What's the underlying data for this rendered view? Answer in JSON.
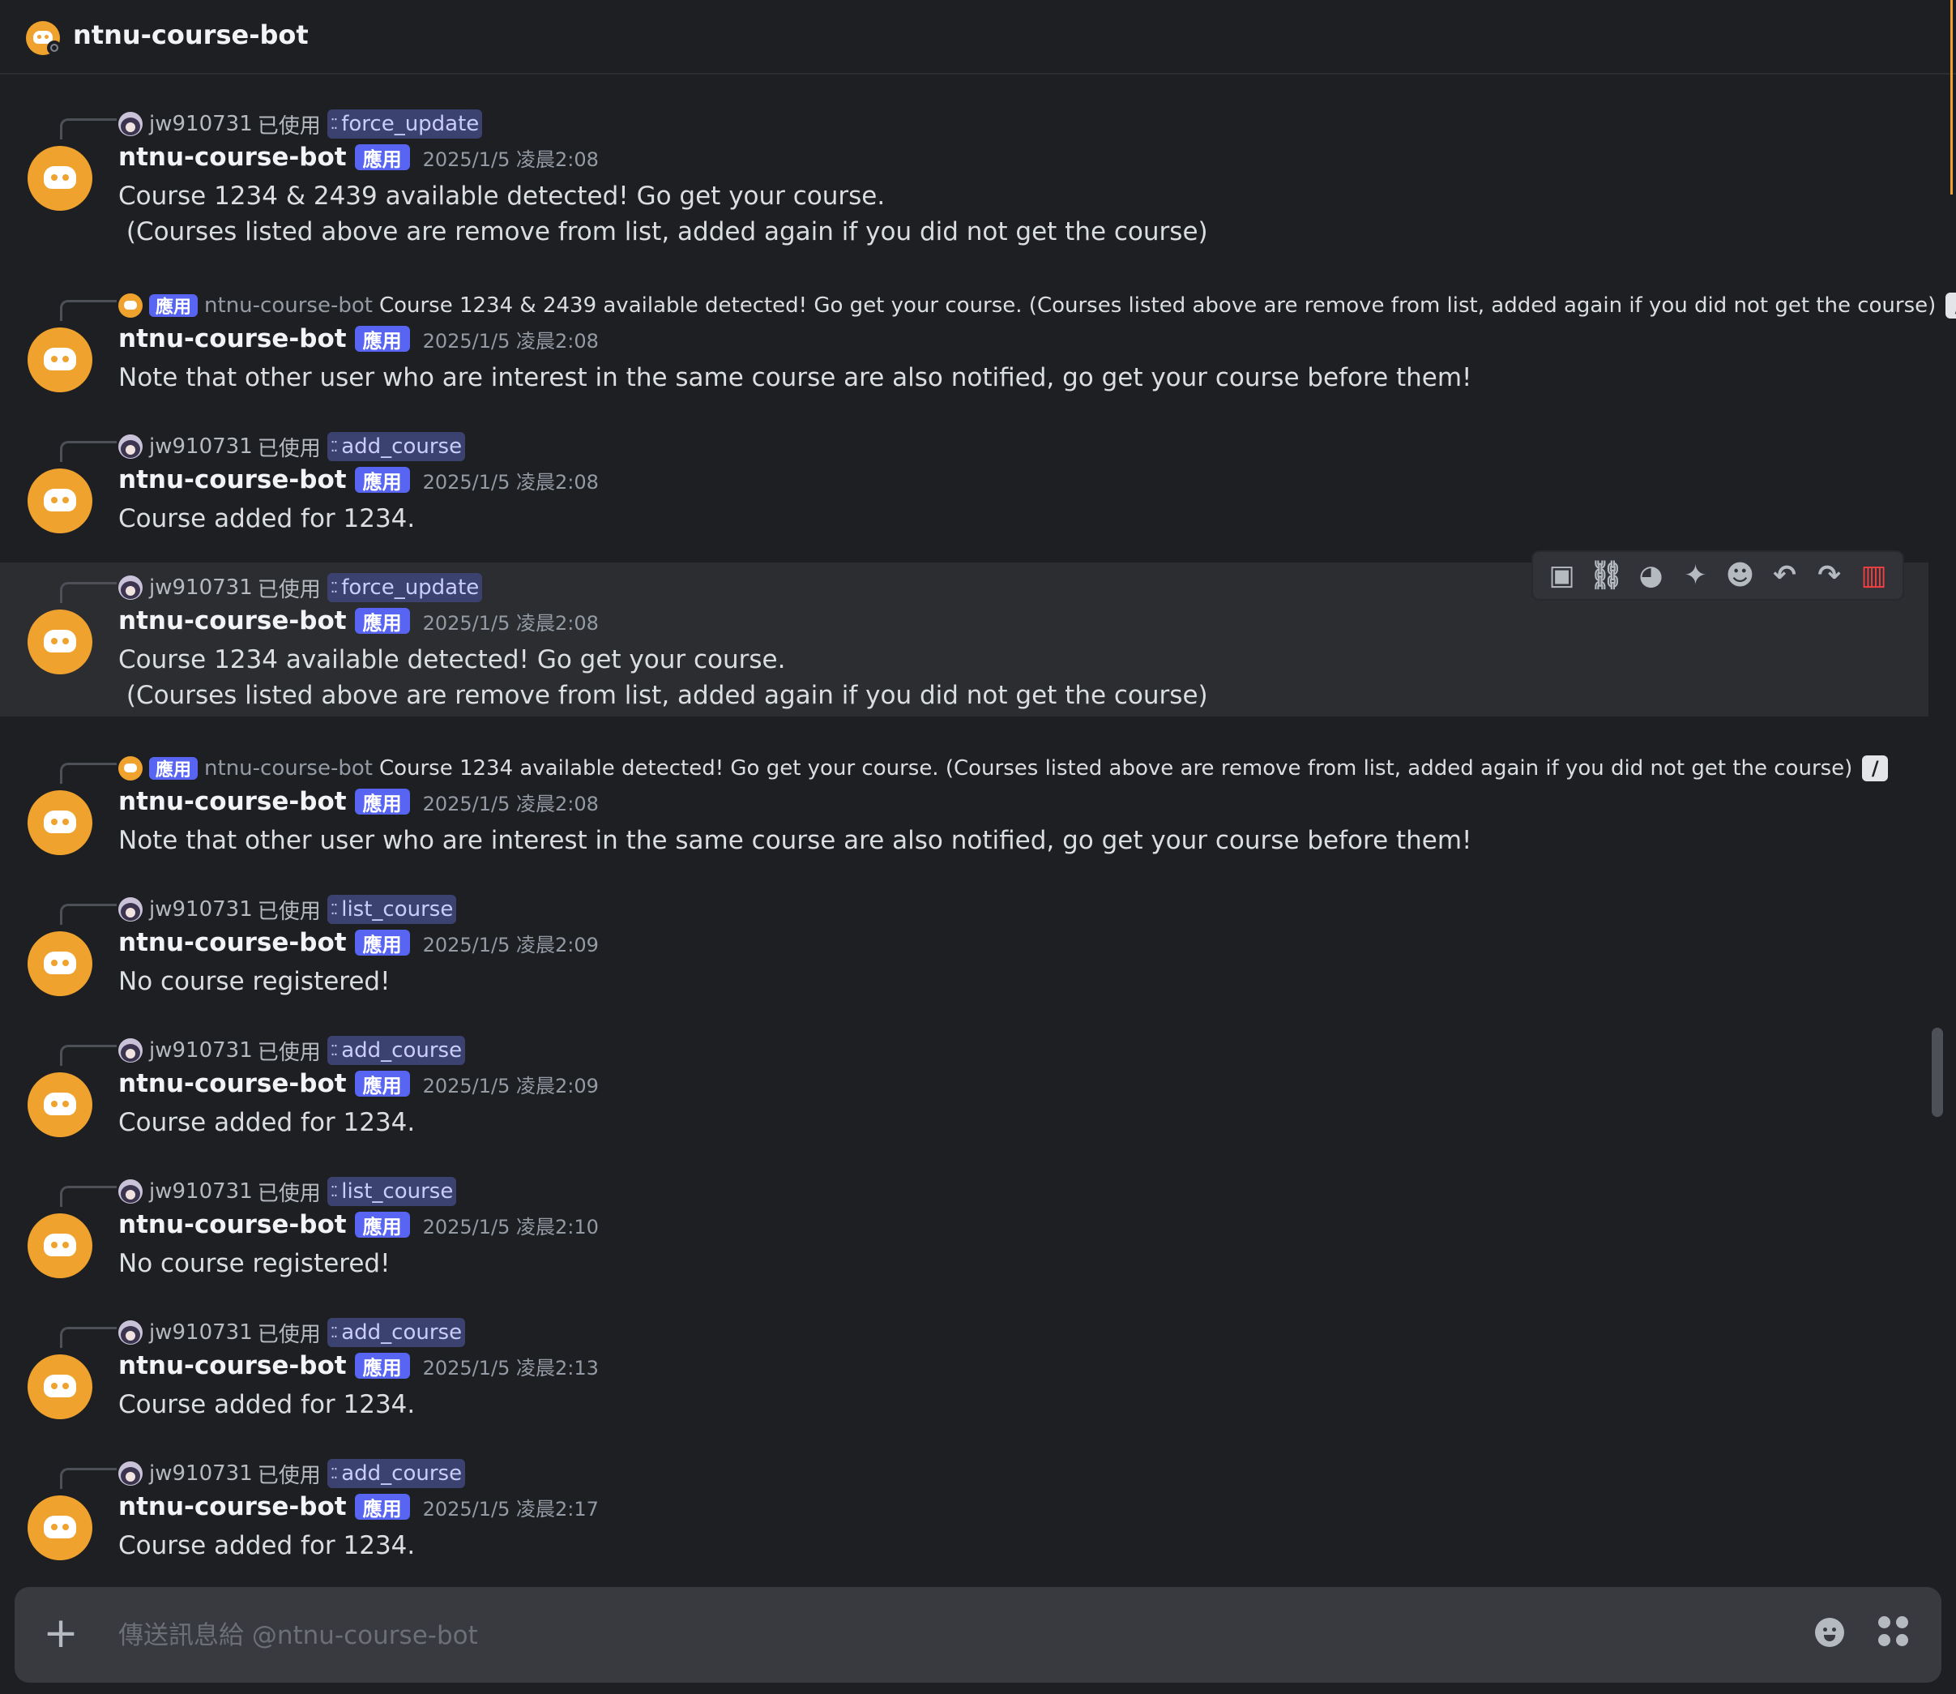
{
  "channel": {
    "title": "ntnu-course-bot"
  },
  "labels": {
    "app_tag": "應用",
    "used_suffix": "已使用",
    "slash": "/"
  },
  "messages": [
    {
      "reply_type": "command",
      "reply_user": "jw910731",
      "command": "force_update",
      "author": "ntnu-course-bot",
      "time": "2025/1/5 凌晨2:08",
      "content": "Course 1234 & 2439 available detected! Go get your course.\n (Courses listed above are remove from list, added again if you did not get the course)"
    },
    {
      "reply_type": "reply",
      "reply_author": "ntnu-course-bot",
      "reply_text": "Course 1234 & 2439 available detected! Go get your course.  (Courses listed above are remove from list, added again if you did not get the course)",
      "author": "ntnu-course-bot",
      "time": "2025/1/5 凌晨2:08",
      "content": "Note that other user who are interest in the same course are also notified, go get your course before them!"
    },
    {
      "reply_type": "command",
      "reply_user": "jw910731",
      "command": "add_course",
      "author": "ntnu-course-bot",
      "time": "2025/1/5 凌晨2:08",
      "content": "Course added for 1234."
    },
    {
      "reply_type": "command",
      "reply_user": "jw910731",
      "command": "force_update",
      "author": "ntnu-course-bot",
      "time": "2025/1/5 凌晨2:08",
      "content": "Course 1234 available detected! Go get your course.\n (Courses listed above are remove from list, added again if you did not get the course)"
    },
    {
      "reply_type": "reply",
      "reply_author": "ntnu-course-bot",
      "reply_text": "Course 1234 available detected! Go get your course.  (Courses listed above are remove from list, added again if you did not get the course)",
      "author": "ntnu-course-bot",
      "time": "2025/1/5 凌晨2:08",
      "content": "Note that other user who are interest in the same course are also notified, go get your course before them!"
    },
    {
      "reply_type": "command",
      "reply_user": "jw910731",
      "command": "list_course",
      "author": "ntnu-course-bot",
      "time": "2025/1/5 凌晨2:09",
      "content": "No course registered!"
    },
    {
      "reply_type": "command",
      "reply_user": "jw910731",
      "command": "add_course",
      "author": "ntnu-course-bot",
      "time": "2025/1/5 凌晨2:09",
      "content": "Course added for 1234."
    },
    {
      "reply_type": "command",
      "reply_user": "jw910731",
      "command": "list_course",
      "author": "ntnu-course-bot",
      "time": "2025/1/5 凌晨2:10",
      "content": "No course registered!"
    },
    {
      "reply_type": "command",
      "reply_user": "jw910731",
      "command": "add_course",
      "author": "ntnu-course-bot",
      "time": "2025/1/5 凌晨2:13",
      "content": "Course added for 1234."
    },
    {
      "reply_type": "command",
      "reply_user": "jw910731",
      "command": "add_course",
      "author": "ntnu-course-bot",
      "time": "2025/1/5 凌晨2:17",
      "content": "Course added for 1234."
    }
  ],
  "toolbar": {
    "icons": [
      "id-icon",
      "link-icon",
      "thread-icon",
      "pin-icon",
      "reaction-icon",
      "reply-icon",
      "forward-icon",
      "delete-icon"
    ],
    "delete_color": "#f23f42"
  },
  "composer": {
    "placeholder": "傳送訊息給 @ntnu-course-bot"
  },
  "colors": {
    "bot_avatar": "#f0a22e",
    "app_tag": "#5865f2",
    "command_pill": "#3c4270",
    "background": "#1e1f22"
  }
}
